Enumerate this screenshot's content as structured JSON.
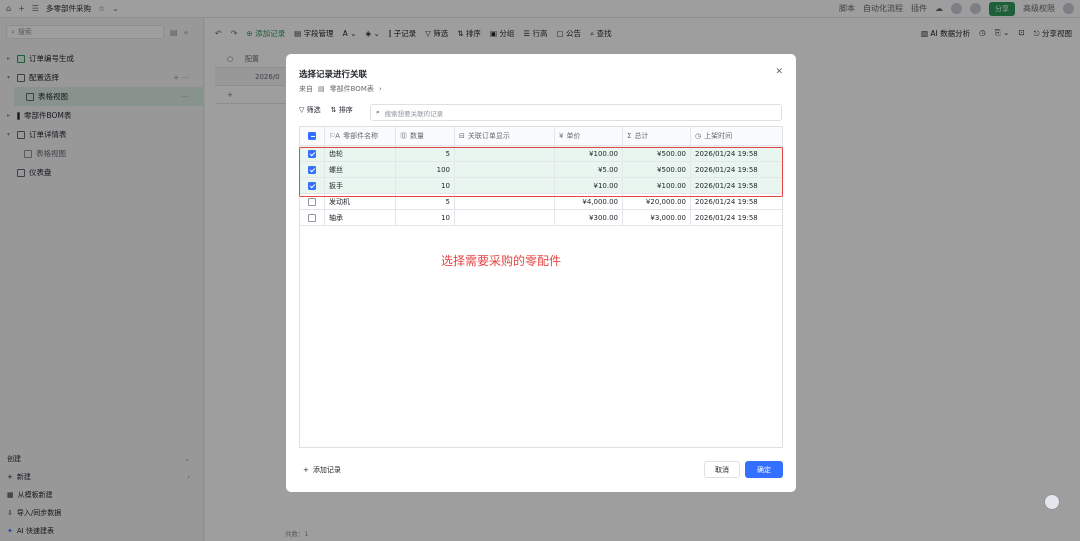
{
  "topbar": {
    "title": "多零部件采购",
    "script_label": "脚本",
    "automation_label": "自动化流程",
    "plugin_label": "插件",
    "share_label": "分享",
    "advanced_label": "高级权限"
  },
  "sidebar": {
    "search_placeholder": "搜索",
    "items": [
      {
        "label": "订单编号生成"
      },
      {
        "label": "配置选择"
      },
      {
        "label": "表格视图"
      },
      {
        "label": "零部件BOM表"
      },
      {
        "label": "订单详情表"
      },
      {
        "label": "表格视图"
      },
      {
        "label": "仪表盘"
      }
    ],
    "create_label": "创建",
    "new_label": "新建",
    "from_template_label": "从模板新建",
    "import_label": "导入/同步数据",
    "ai_label": "AI 快速建表"
  },
  "toolbar": {
    "add_record": "添加记录",
    "field_manage": "字段管理",
    "sub_record": "子记录",
    "filter": "筛选",
    "sort": "排序",
    "group": "分组",
    "row_height": "行高",
    "notice": "公告",
    "find": "查找",
    "ai_analysis": "AI 数据分析",
    "share_view": "分享视图"
  },
  "background_grid": {
    "header_col": "配置",
    "row_value": "2026/0",
    "count_label": "共数：1"
  },
  "modal": {
    "title": "选择记录进行关联",
    "source_prefix": "来自",
    "source_table": "零部件BOM表",
    "filter_label": "筛选",
    "sort_label": "排序",
    "search_placeholder": "搜索想要关联的记录",
    "columns": [
      "零部件名称",
      "数量",
      "关联订单显示",
      "单价",
      "总计",
      "上架时间"
    ],
    "rows": [
      {
        "checked": true,
        "name": "齿轮",
        "qty": "5",
        "link": "",
        "price": "¥100.00",
        "total": "¥500.00",
        "time": "2026/01/24 19:58"
      },
      {
        "checked": true,
        "name": "螺丝",
        "qty": "100",
        "link": "",
        "price": "¥5.00",
        "total": "¥500.00",
        "time": "2026/01/24 19:58"
      },
      {
        "checked": true,
        "name": "扳手",
        "qty": "10",
        "link": "",
        "price": "¥10.00",
        "total": "¥100.00",
        "time": "2026/01/24 19:58"
      },
      {
        "checked": false,
        "name": "发动机",
        "qty": "5",
        "link": "",
        "price": "¥4,000.00",
        "total": "¥20,000.00",
        "time": "2026/01/24 19:58"
      },
      {
        "checked": false,
        "name": "轴承",
        "qty": "10",
        "link": "",
        "price": "¥300.00",
        "total": "¥3,000.00",
        "time": "2026/01/24 19:58"
      }
    ],
    "annotation": "选择需要采购的零配件",
    "add_record": "添加记录",
    "cancel": "取消",
    "confirm": "确定"
  },
  "colors": {
    "accent": "#3370ff",
    "brand_green": "#2e9a5d",
    "annotation_red": "#e54545"
  }
}
